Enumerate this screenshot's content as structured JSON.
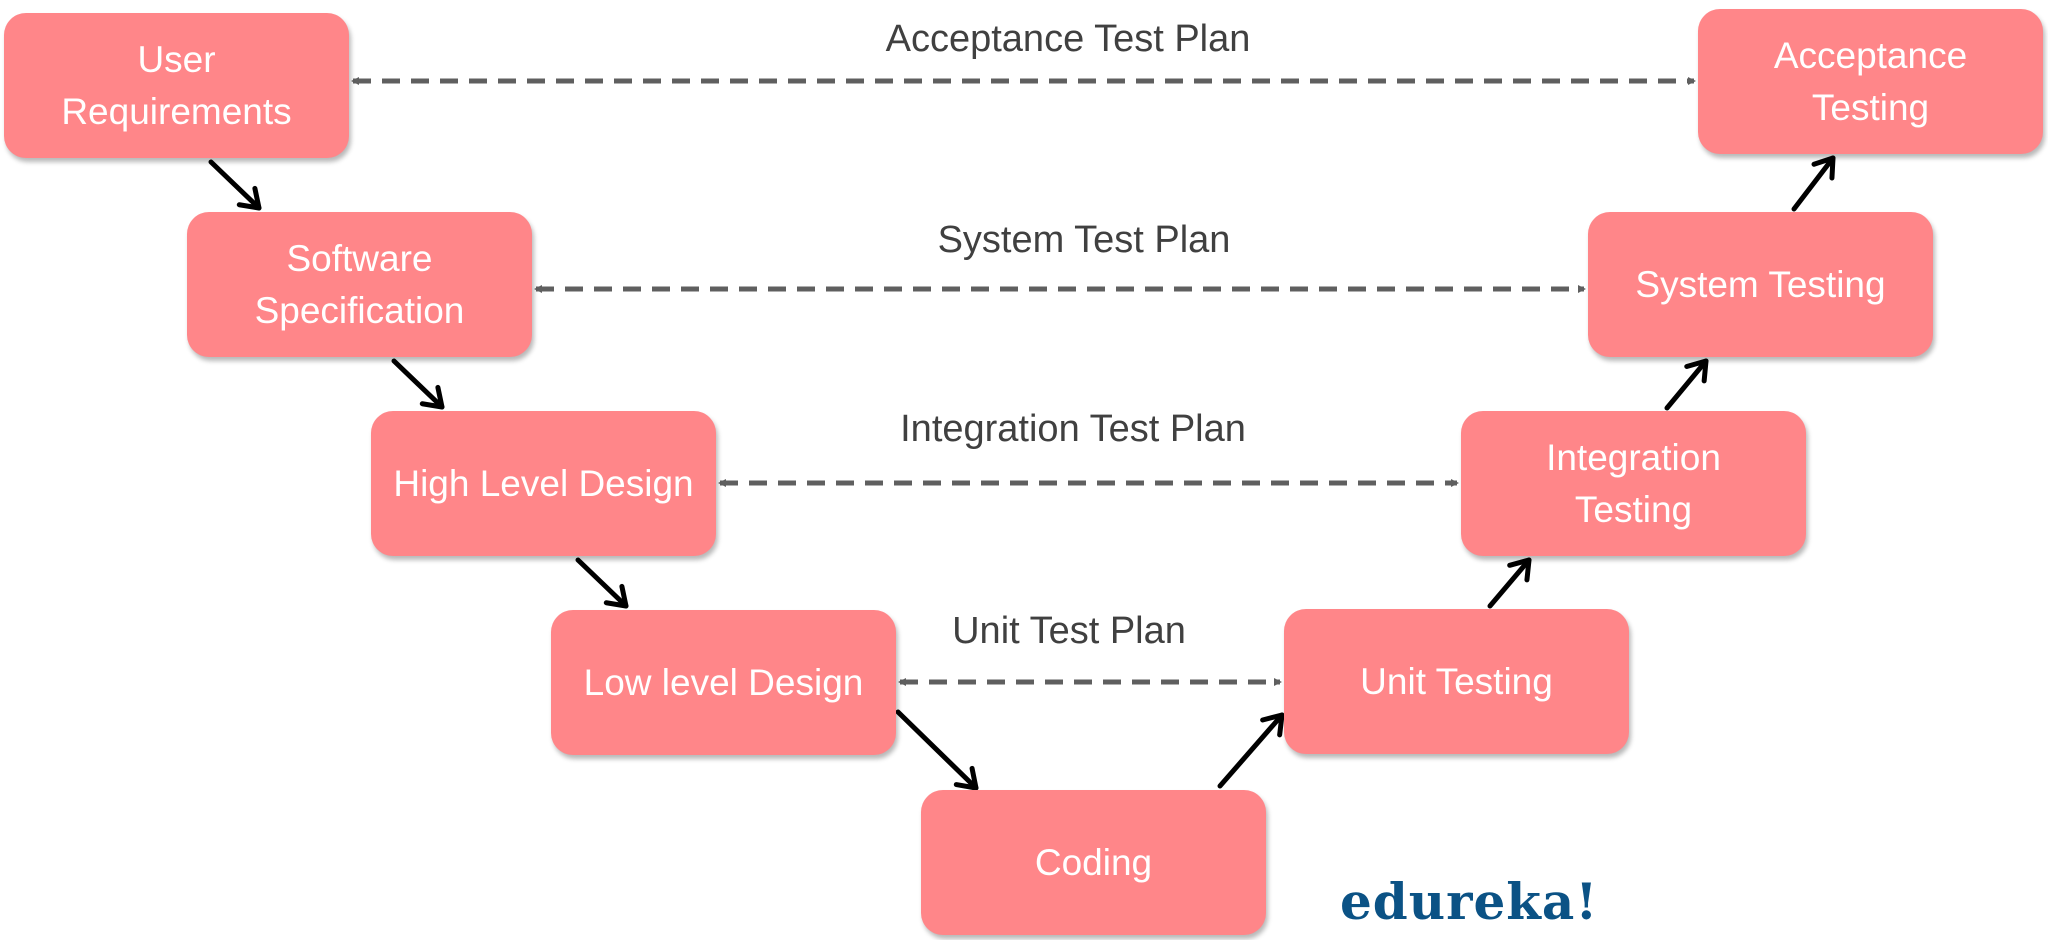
{
  "diagram": {
    "type": "V-Model",
    "colors": {
      "box": "#ff8689",
      "box_text": "#ffffff",
      "plan_text": "#404040",
      "dashed_line": "#5f5f5f",
      "flow_arrow": "#000000",
      "logo": "#0b5285"
    },
    "left_phases": [
      {
        "id": "user-requirements",
        "label": "User\nRequirements"
      },
      {
        "id": "software-specification",
        "label": "Software\nSpecification"
      },
      {
        "id": "high-level-design",
        "label": "High Level Design"
      },
      {
        "id": "low-level-design",
        "label": "Low level Design"
      }
    ],
    "bottom_phase": {
      "id": "coding",
      "label": "Coding"
    },
    "right_phases": [
      {
        "id": "unit-testing",
        "label": "Unit Testing"
      },
      {
        "id": "integration-testing",
        "label": "Integration\nTesting"
      },
      {
        "id": "system-testing",
        "label": "System Testing"
      },
      {
        "id": "acceptance-testing",
        "label": "Acceptance\nTesting"
      }
    ],
    "test_plans": [
      {
        "label": "Acceptance Test Plan",
        "from": "user-requirements",
        "to": "acceptance-testing"
      },
      {
        "label": "System Test Plan",
        "from": "software-specification",
        "to": "system-testing"
      },
      {
        "label": "Integration Test Plan",
        "from": "high-level-design",
        "to": "integration-testing"
      },
      {
        "label": "Unit Test Plan",
        "from": "low-level-design",
        "to": "unit-testing"
      }
    ],
    "flow": [
      "user-requirements",
      "software-specification",
      "high-level-design",
      "low-level-design",
      "coding",
      "unit-testing",
      "integration-testing",
      "system-testing",
      "acceptance-testing"
    ]
  },
  "logo": {
    "text": "edureka!"
  }
}
